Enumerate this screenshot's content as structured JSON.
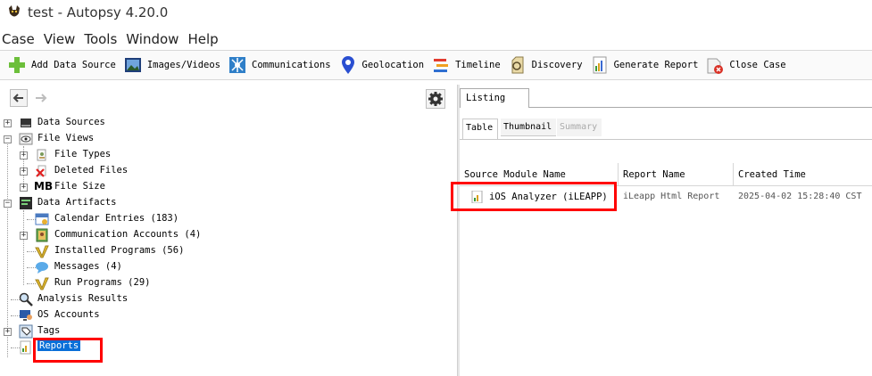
{
  "window": {
    "title": "test - Autopsy 4.20.0"
  },
  "menu": [
    "Case",
    "View",
    "Tools",
    "Window",
    "Help"
  ],
  "toolbar": [
    {
      "label": "Add Data Source",
      "icon": "plus-icon"
    },
    {
      "label": "Images/Videos",
      "icon": "images-icon"
    },
    {
      "label": "Communications",
      "icon": "communications-icon"
    },
    {
      "label": "Geolocation",
      "icon": "map-pin-icon"
    },
    {
      "label": "Timeline",
      "icon": "timeline-icon"
    },
    {
      "label": "Discovery",
      "icon": "discovery-icon"
    },
    {
      "label": "Generate Report",
      "icon": "report-icon"
    },
    {
      "label": "Close Case",
      "icon": "close-case-icon"
    }
  ],
  "tree": {
    "data_sources": "Data Sources",
    "file_views": "File Views",
    "file_types": "File Types",
    "deleted_files": "Deleted Files",
    "file_size": "File Size",
    "file_size_icon_text": "MB",
    "data_artifacts": "Data Artifacts",
    "calendar_entries": "Calendar Entries (183)",
    "communication_accounts": "Communication Accounts (4)",
    "installed_programs": "Installed Programs (56)",
    "messages": "Messages (4)",
    "run_programs": "Run Programs (29)",
    "analysis_results": "Analysis Results",
    "os_accounts": "OS Accounts",
    "tags": "Tags",
    "reports": "Reports"
  },
  "right": {
    "listing_tab": "Listing",
    "subtabs": {
      "table": "Table",
      "thumbnail": "Thumbnail",
      "summary": "Summary"
    },
    "columns": {
      "source_module": "Source Module Name",
      "report_name": "Report Name",
      "created_time": "Created Time"
    },
    "row": {
      "source_module": "iOS Analyzer (iLEAPP)",
      "report_name": "iLeapp Html Report",
      "created_time": "2025-04-02 15:28:40 CST"
    }
  },
  "colors": {
    "selection": "#0a6fd8",
    "highlight": "#ff0000"
  }
}
